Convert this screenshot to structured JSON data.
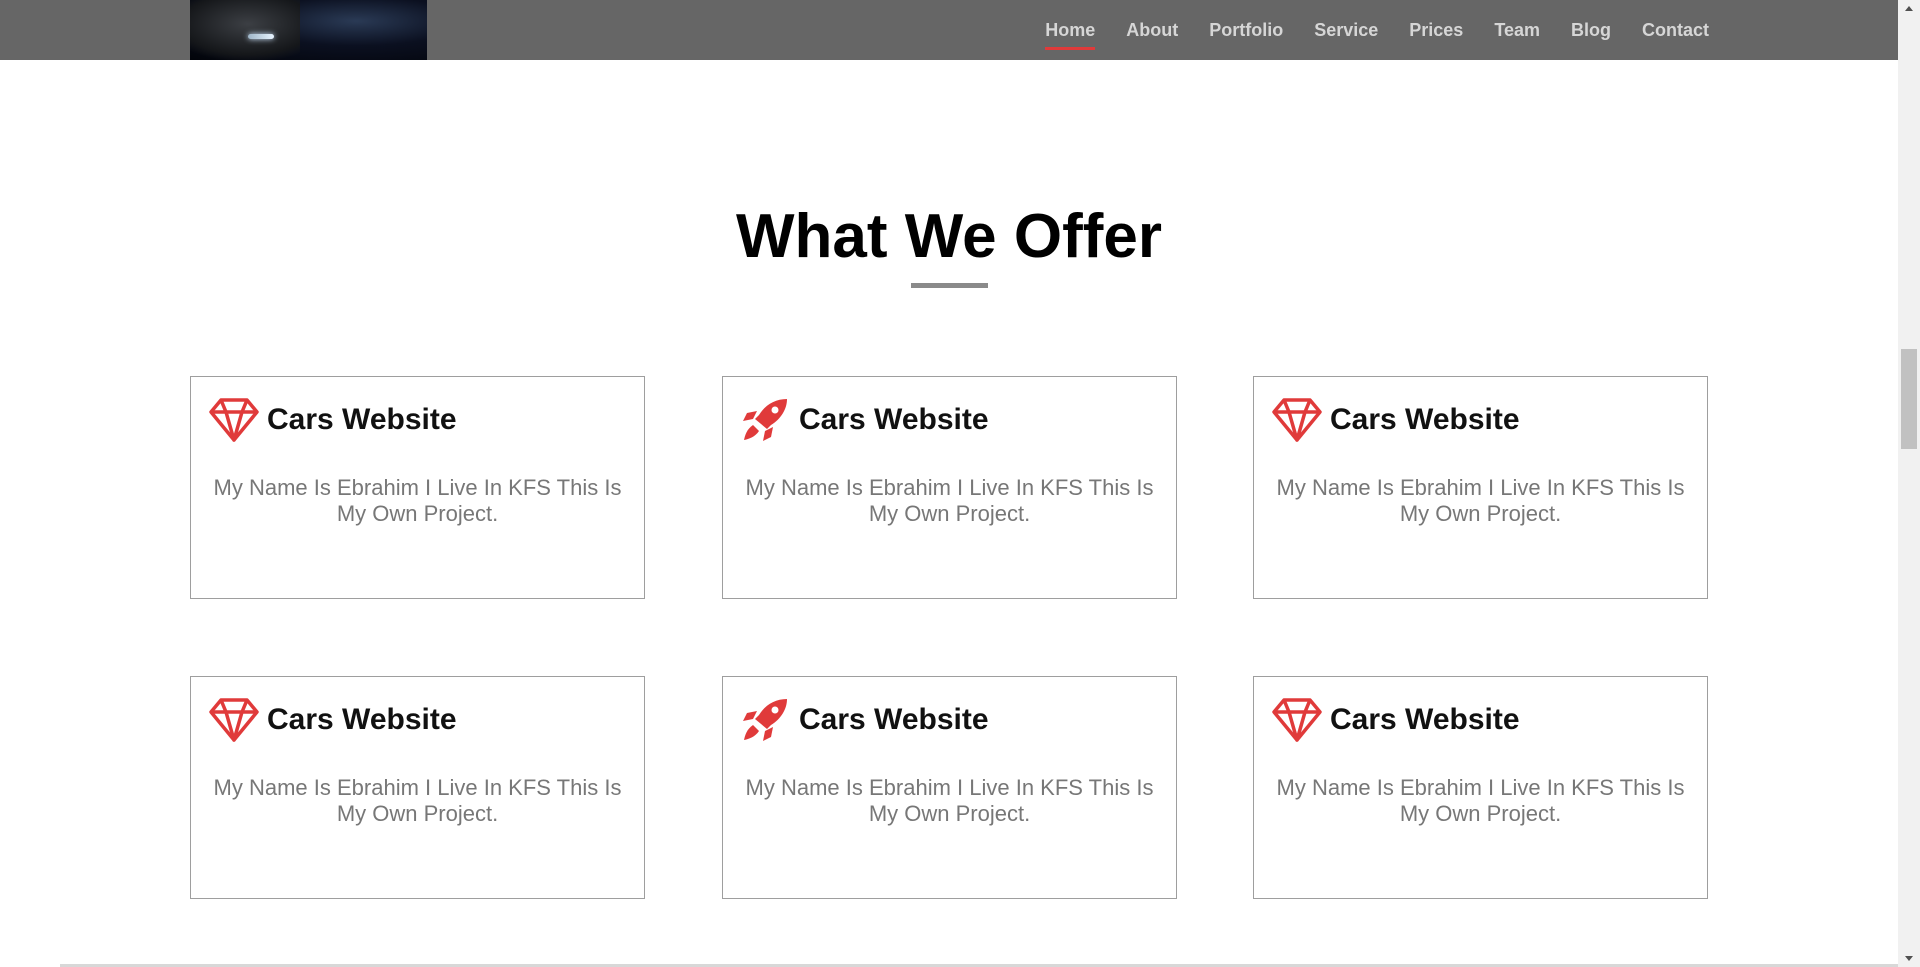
{
  "header": {
    "nav": [
      {
        "label": "Home",
        "active": true
      },
      {
        "label": "About"
      },
      {
        "label": "Portfolio"
      },
      {
        "label": "Service"
      },
      {
        "label": "Prices"
      },
      {
        "label": "Team"
      },
      {
        "label": "Blog"
      },
      {
        "label": "Contact"
      }
    ]
  },
  "section": {
    "title": "What We Offer"
  },
  "cards": [
    {
      "icon": "diamond-icon",
      "title": "Cars Website",
      "text": "My Name Is Ebrahim I Live In KFS This Is My Own Project."
    },
    {
      "icon": "rocket-icon",
      "title": "Cars Website",
      "text": "My Name Is Ebrahim I Live In KFS This Is My Own Project."
    },
    {
      "icon": "diamond-icon",
      "title": "Cars Website",
      "text": "My Name Is Ebrahim I Live In KFS This Is My Own Project."
    },
    {
      "icon": "diamond-icon",
      "title": "Cars Website",
      "text": "My Name Is Ebrahim I Live In KFS This Is My Own Project."
    },
    {
      "icon": "rocket-icon",
      "title": "Cars Website",
      "text": "My Name Is Ebrahim I Live In KFS This Is My Own Project."
    },
    {
      "icon": "diamond-icon",
      "title": "Cars Website",
      "text": "My Name Is Ebrahim I Live In KFS This Is My Own Project."
    }
  ],
  "colors": {
    "accent": "#e03a3a",
    "header_bg": "#666666",
    "nav_text": "#d6d6d6",
    "body_text": "#777777"
  }
}
